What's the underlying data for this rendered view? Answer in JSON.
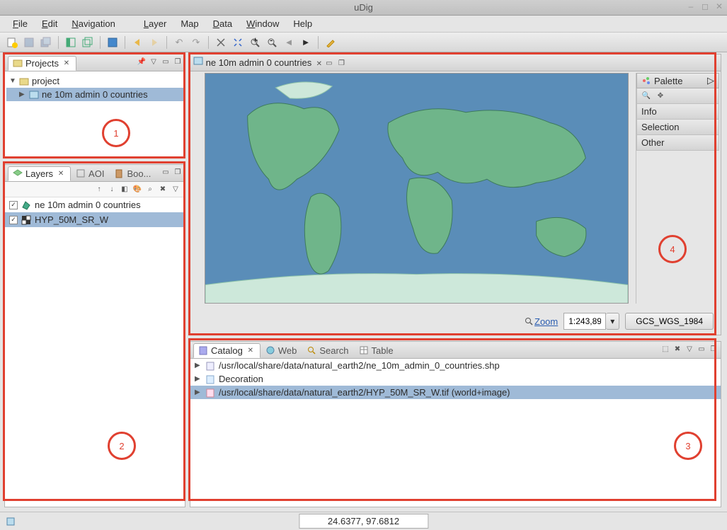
{
  "window": {
    "title": "uDig"
  },
  "menu": {
    "file": "File",
    "edit": "Edit",
    "navigation": "Navigation",
    "layer": "Layer",
    "map": "Map",
    "data": "Data",
    "window": "Window",
    "help": "Help"
  },
  "projects": {
    "tab_label": "Projects",
    "root": "project",
    "child": "ne 10m admin 0 countries"
  },
  "layers": {
    "tab_layers": "Layers",
    "tab_aoi": "AOI",
    "tab_boo": "Boo...",
    "row1": "ne 10m admin 0 countries",
    "row2": "HYP_50M_SR_W"
  },
  "map": {
    "tab": "ne 10m admin 0 countries",
    "zoom_label": "Zoom",
    "zoom_value": "1:243,89",
    "crs": "GCS_WGS_1984"
  },
  "palette": {
    "title": "Palette",
    "info": "Info",
    "selection": "Selection",
    "other": "Other"
  },
  "catalog": {
    "tab_catalog": "Catalog",
    "tab_web": "Web",
    "tab_search": "Search",
    "tab_table": "Table",
    "row1": "/usr/local/share/data/natural_earth2/ne_10m_admin_0_countries.shp",
    "row2": "Decoration",
    "row3": "/usr/local/share/data/natural_earth2/HYP_50M_SR_W.tif (world+image)"
  },
  "status": {
    "coords": "24.6377, 97.6812"
  },
  "annotations": {
    "n1": "1",
    "n2": "2",
    "n3": "3",
    "n4": "4"
  }
}
